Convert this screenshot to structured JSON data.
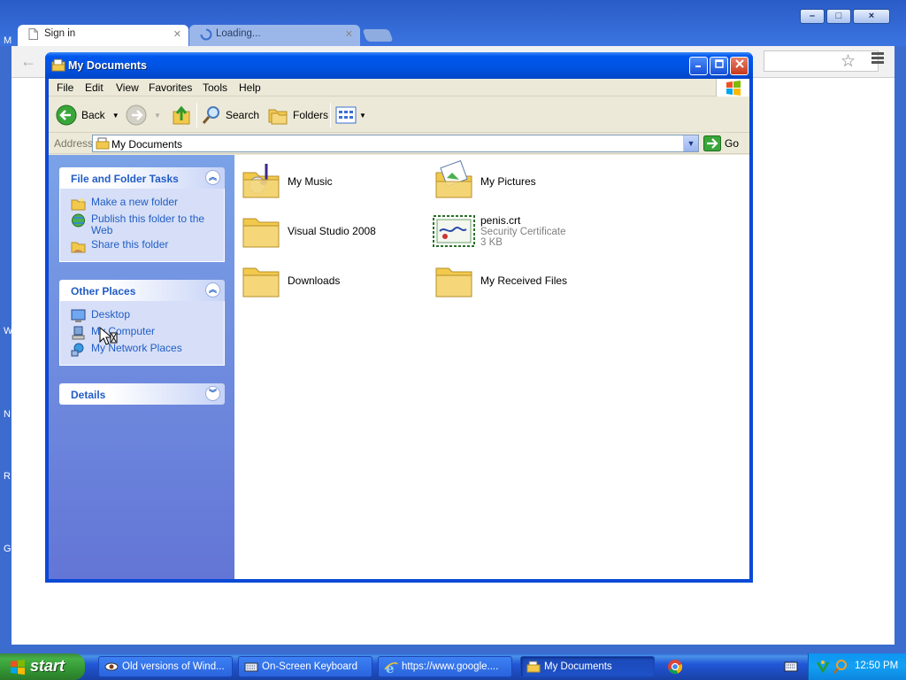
{
  "browser": {
    "tabs": [
      {
        "label": "Sign in"
      },
      {
        "label": "Loading..."
      }
    ],
    "window_buttons": [
      "–",
      "□",
      "×"
    ],
    "side_letters": [
      "M",
      "W",
      "N",
      "R",
      "G"
    ]
  },
  "explorer": {
    "title": "My Documents",
    "menu": [
      "File",
      "Edit",
      "View",
      "Favorites",
      "Tools",
      "Help"
    ],
    "toolbar": {
      "back": "Back",
      "search": "Search",
      "folders": "Folders"
    },
    "address": {
      "label": "Address",
      "value": "My Documents",
      "go": "Go"
    },
    "tasks": {
      "file_folder": {
        "title": "File and Folder Tasks",
        "items": [
          "Make a new folder",
          "Publish this folder to the Web",
          "Share this folder"
        ]
      },
      "other_places": {
        "title": "Other Places",
        "items": [
          "Desktop",
          "My Computer",
          "My Network Places"
        ]
      },
      "details": {
        "title": "Details"
      }
    },
    "files": [
      {
        "name": "My Music",
        "sub1": "",
        "sub2": "",
        "icon": "music-folder-icon"
      },
      {
        "name": "My Pictures",
        "sub1": "",
        "sub2": "",
        "icon": "pictures-folder-icon"
      },
      {
        "name": "Visual Studio 2008",
        "sub1": "",
        "sub2": "",
        "icon": "folder-icon"
      },
      {
        "name": "penis.crt",
        "sub1": "Security Certificate",
        "sub2": "3 KB",
        "icon": "certificate-icon"
      },
      {
        "name": "Downloads",
        "sub1": "",
        "sub2": "",
        "icon": "folder-icon"
      },
      {
        "name": "My Received Files",
        "sub1": "",
        "sub2": "",
        "icon": "folder-icon"
      }
    ]
  },
  "taskbar": {
    "start": "start",
    "buttons": [
      {
        "label": "Old versions of Wind..."
      },
      {
        "label": "On-Screen Keyboard"
      },
      {
        "label": "https://www.google...."
      },
      {
        "label": "My Documents"
      }
    ],
    "clock": "12:50 PM"
  }
}
